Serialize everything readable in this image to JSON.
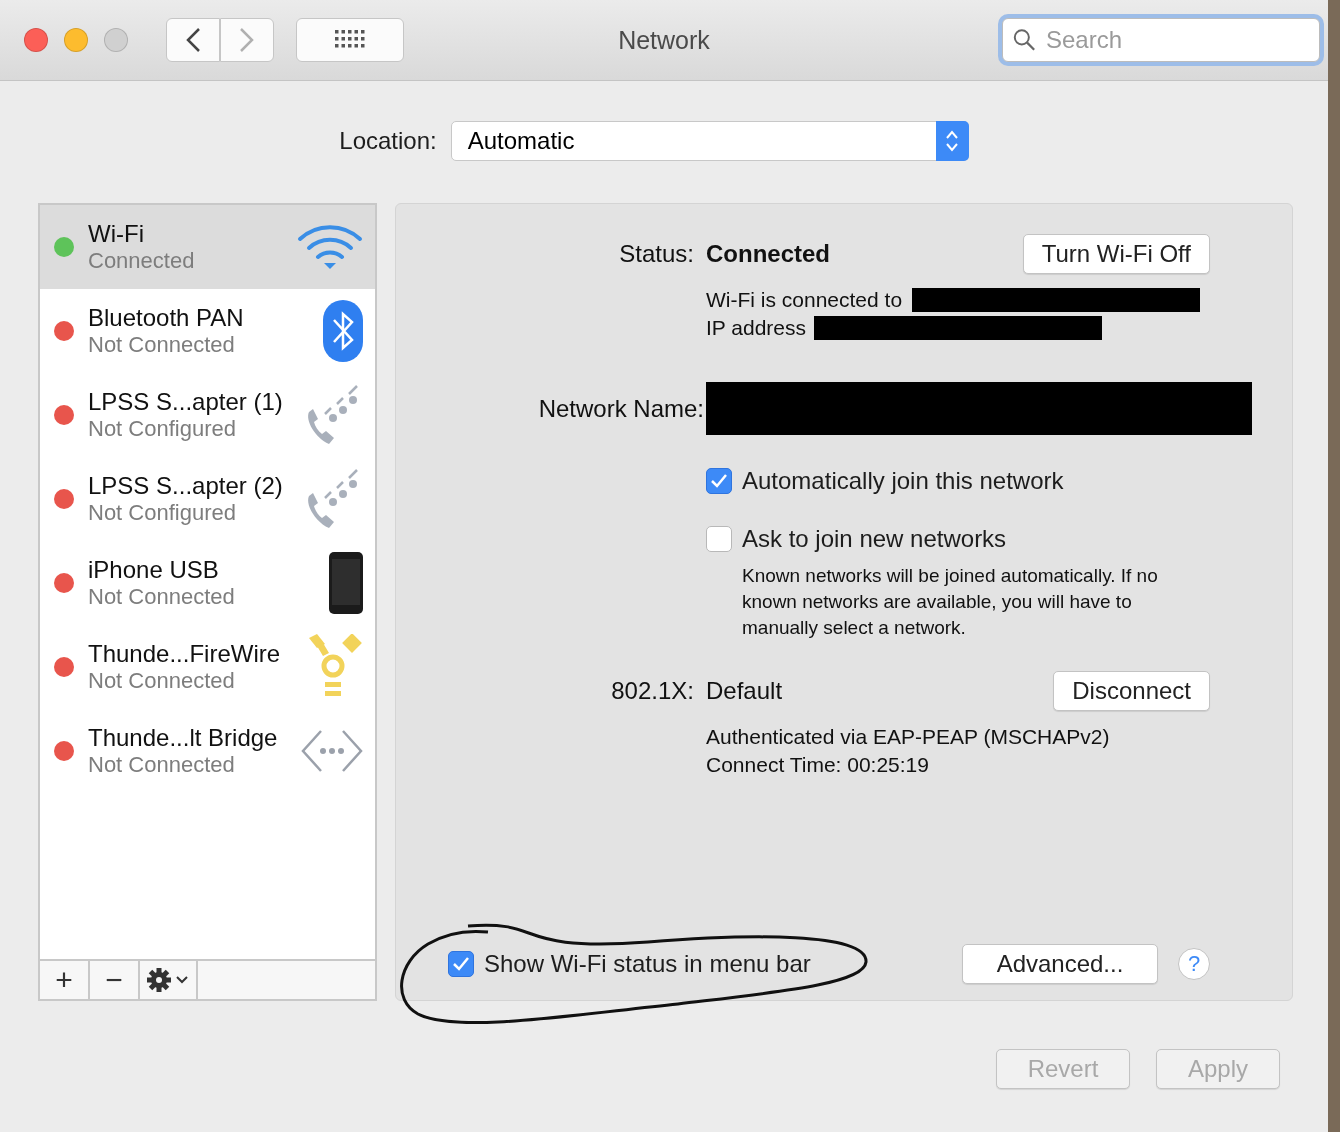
{
  "window": {
    "title": "Network"
  },
  "search": {
    "placeholder": "Search"
  },
  "location": {
    "label": "Location:",
    "value": "Automatic"
  },
  "services": [
    {
      "name": "Wi-Fi",
      "status": "Connected",
      "color": "#5ec35a",
      "selected": true,
      "kind": "wifi"
    },
    {
      "name": "Bluetooth PAN",
      "status": "Not Connected",
      "color": "#e8554c",
      "selected": false,
      "kind": "bluetooth"
    },
    {
      "name": "LPSS S...apter (1)",
      "status": "Not Configured",
      "color": "#e8554c",
      "selected": false,
      "kind": "phone"
    },
    {
      "name": "LPSS S...apter (2)",
      "status": "Not Configured",
      "color": "#e8554c",
      "selected": false,
      "kind": "phone"
    },
    {
      "name": "iPhone USB",
      "status": "Not Connected",
      "color": "#e8554c",
      "selected": false,
      "kind": "iphone"
    },
    {
      "name": "Thunde...FireWire",
      "status": "Not Connected",
      "color": "#e8554c",
      "selected": false,
      "kind": "firewire"
    },
    {
      "name": "Thunde...lt Bridge",
      "status": "Not Connected",
      "color": "#e8554c",
      "selected": false,
      "kind": "bridge"
    }
  ],
  "sidebar_toolbar": [
    "+",
    "−"
  ],
  "status": {
    "label": "Status:",
    "value": "Connected",
    "button": "Turn Wi-Fi Off",
    "lines": [
      "Wi-Fi is connected to",
      "IP address"
    ]
  },
  "network_name": {
    "label": "Network Name:"
  },
  "options": [
    {
      "label": "Automatically join this network",
      "checked": true
    },
    {
      "label": "Ask to join new networks",
      "checked": false
    }
  ],
  "note": "Known networks will be joined automatically. If no known networks are available, you will have to manually select a network.",
  "security": {
    "label": "802.1X:",
    "value": "Default",
    "button": "Disconnect",
    "lines": [
      "Authenticated via EAP-PEAP (MSCHAPv2)",
      "Connect Time: 00:25:19"
    ]
  },
  "show_in_menu_bar": {
    "label": "Show Wi-Fi status in menu bar",
    "checked": true
  },
  "advanced_button": "Advanced...",
  "help": "?",
  "footer_buttons": [
    {
      "label": "Revert",
      "disabled": true
    },
    {
      "label": "Apply",
      "disabled": true
    }
  ]
}
